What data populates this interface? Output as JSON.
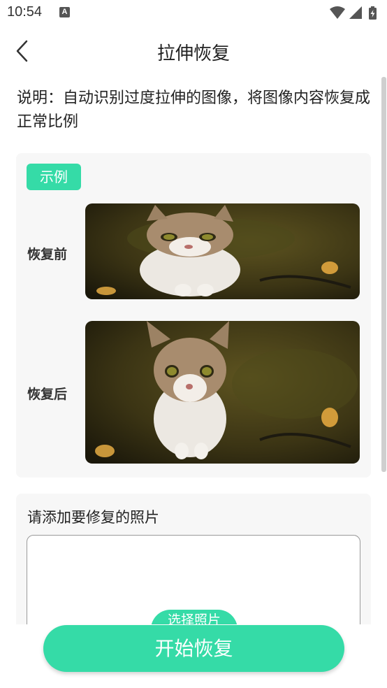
{
  "status_bar": {
    "time": "10:54",
    "notification_badge": "A",
    "icons": [
      "wifi-icon",
      "cell-signal-icon",
      "battery-charging-icon"
    ]
  },
  "header": {
    "title": "拉伸恢复",
    "back_icon": "chevron-left-icon"
  },
  "description": "说明：自动识别过度拉伸的图像，将图像内容恢复成正常比例",
  "example": {
    "badge": "示例",
    "before_label": "恢复前",
    "after_label": "恢复后"
  },
  "upload": {
    "title": "请添加要修复的照片",
    "select_button": "选择照片"
  },
  "action": {
    "start_button": "开始恢复"
  },
  "colors": {
    "accent": "#35dba7",
    "card_background": "#f7f7f7",
    "text": "#222222"
  }
}
